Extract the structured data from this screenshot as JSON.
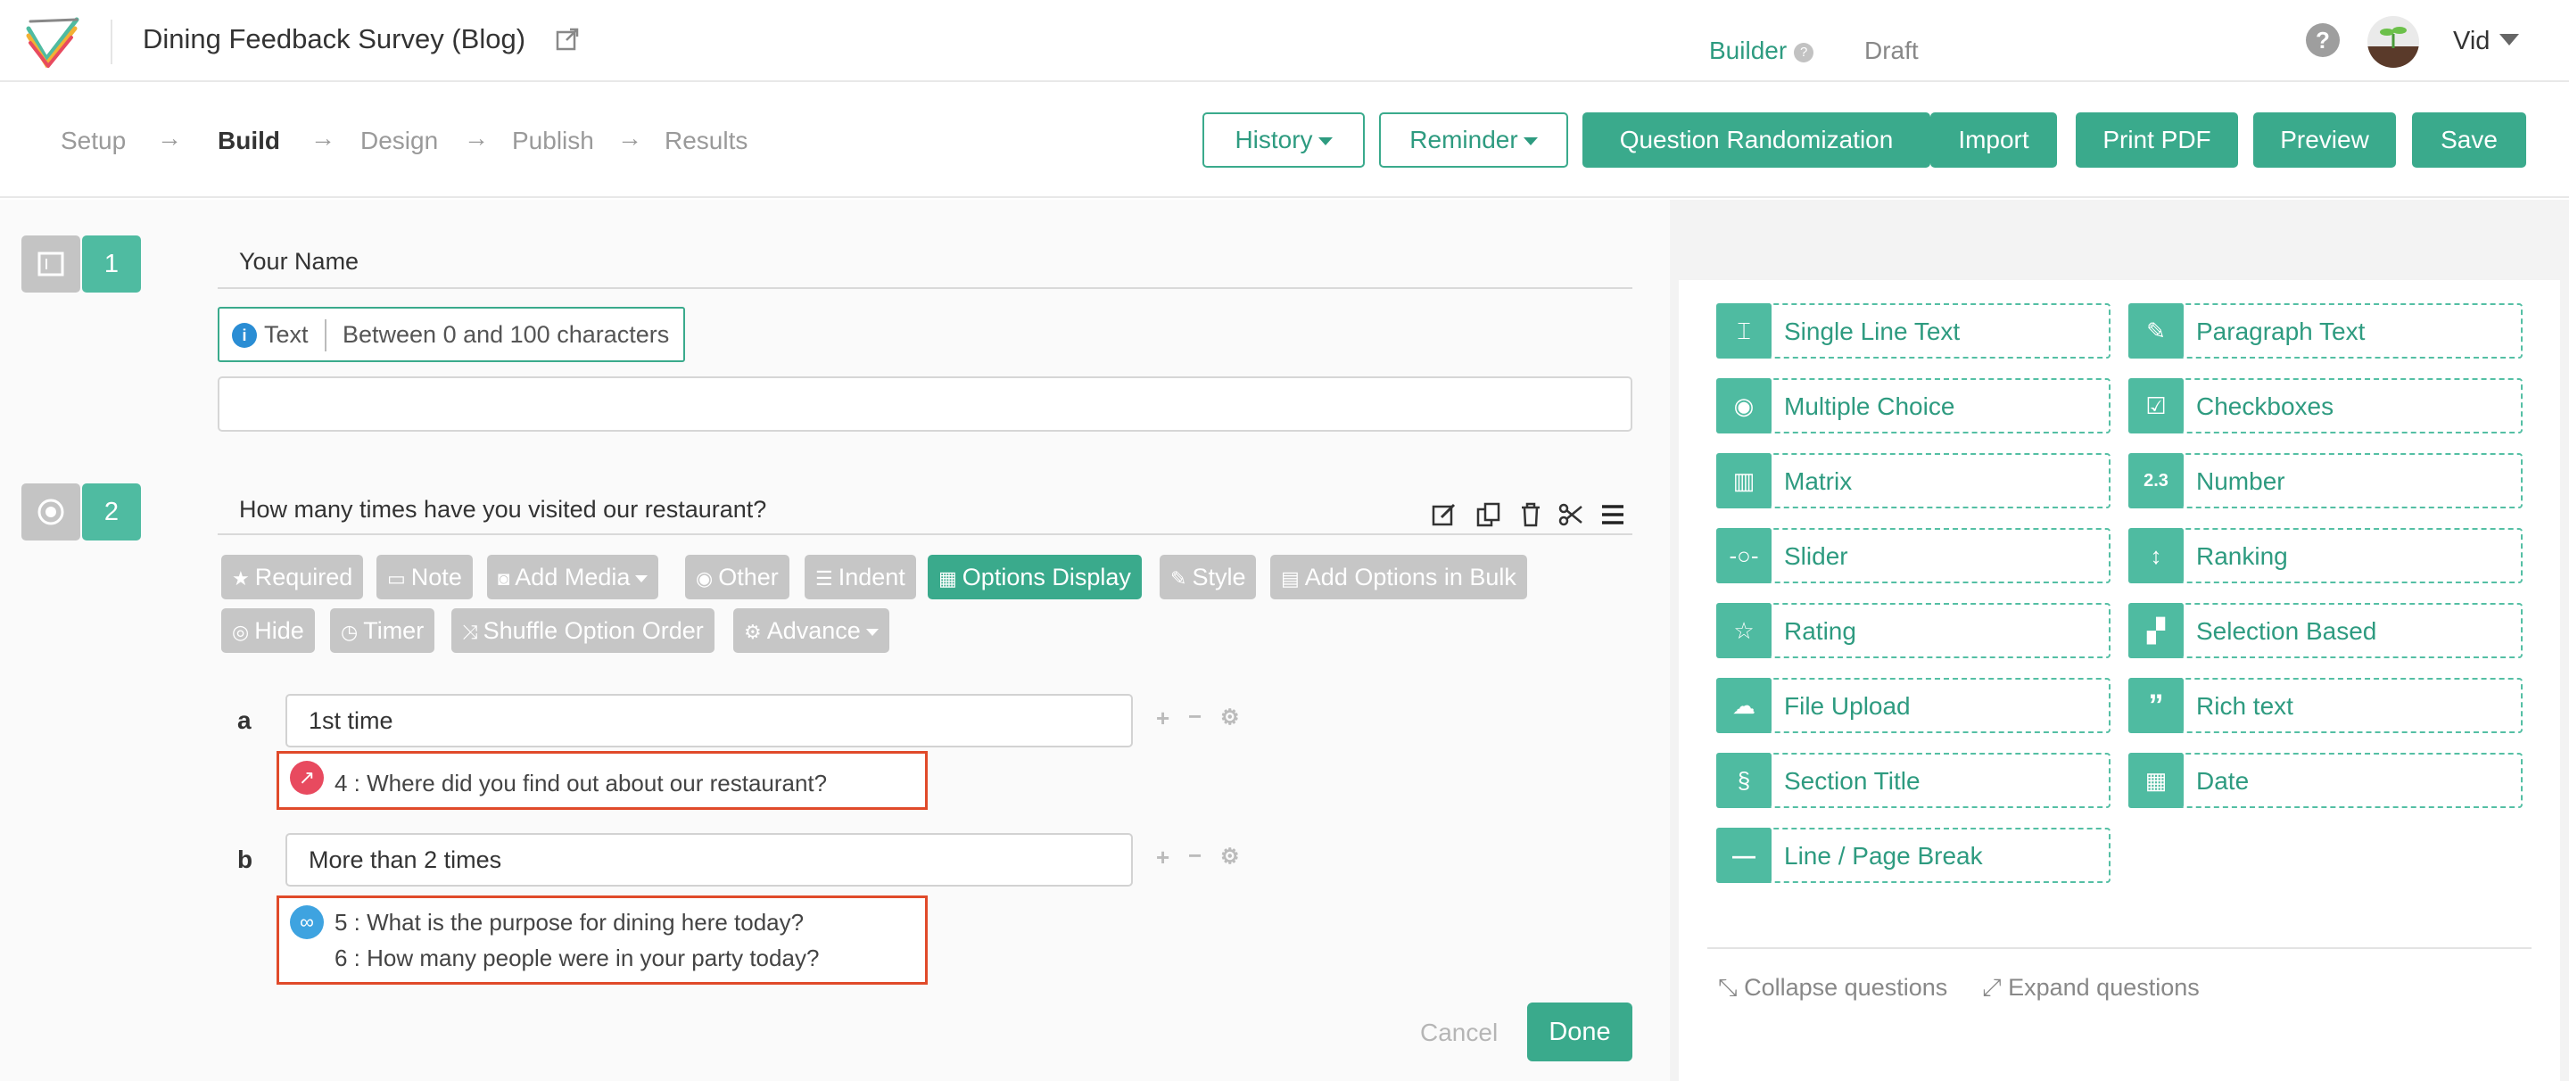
{
  "header": {
    "survey_title": "Dining Feedback Survey (Blog)",
    "user_name": "Vid"
  },
  "steps": [
    "Setup",
    "Build",
    "Design",
    "Publish",
    "Results"
  ],
  "active_step": "Build",
  "toolbar": {
    "history": "History",
    "reminder": "Reminder",
    "question_randomization": "Question Randomization",
    "import": "Import",
    "print_pdf": "Print PDF",
    "preview": "Preview",
    "save": "Save"
  },
  "questions": [
    {
      "number": "1",
      "title": "Your Name",
      "type_label": "Text",
      "constraint": "Between 0 and 100 characters"
    },
    {
      "number": "2",
      "title": "How many times have you visited our restaurant?",
      "tools_row1": [
        "Required",
        "Note",
        "Add Media",
        "Other",
        "Indent",
        "Options Display",
        "Style",
        "Add Options in Bulk"
      ],
      "tools_row2": [
        "Hide",
        "Timer",
        "Shuffle Option Order",
        "Advance"
      ],
      "options": [
        {
          "letter": "a",
          "value": "1st time",
          "logic": [
            "4 : Where did you find out about our restaurant?"
          ]
        },
        {
          "letter": "b",
          "value": "More than 2 times",
          "logic": [
            "5 : What is the purpose for dining here today?",
            "6 : How many people were in your party today?"
          ]
        }
      ],
      "cancel": "Cancel",
      "done": "Done"
    }
  ],
  "right_panel": {
    "tabs": [
      "Builder",
      "Draft"
    ],
    "field_types": [
      "Single Line Text",
      "Paragraph Text",
      "Multiple Choice",
      "Checkboxes",
      "Matrix",
      "Number",
      "Slider",
      "Ranking",
      "Rating",
      "Selection Based",
      "File Upload",
      "Rich text",
      "Section Title",
      "Date",
      "Line / Page Break"
    ],
    "number_icon_text": "2.3",
    "collapse_questions": "Collapse questions",
    "expand_questions": "Expand questions"
  },
  "colors": {
    "accent": "#3aaa8c",
    "logic_border": "#e04a2a",
    "skip_icon": "#e84a5f",
    "link_icon": "#3ea3e0"
  }
}
